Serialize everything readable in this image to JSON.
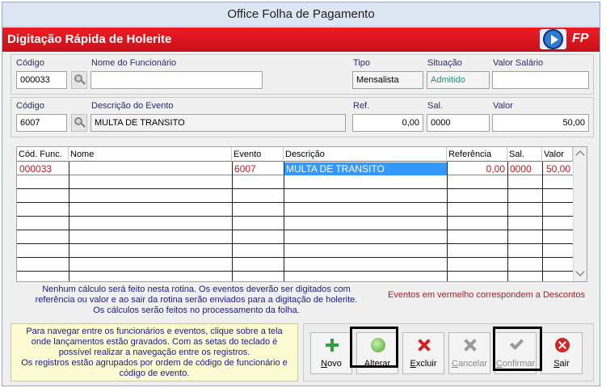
{
  "window": {
    "title": "Office Folha de Pagamento"
  },
  "banner": {
    "title": "Digitação Rápida de Holerite",
    "logo_text": "FP",
    "play_icon": "play-circle-icon"
  },
  "employee": {
    "codigo_label": "Código",
    "codigo_value": "000033",
    "nome_label": "Nome do Funcionário",
    "nome_value": "",
    "tipo_label": "Tipo",
    "tipo_value": "Mensalista",
    "situacao_label": "Situação",
    "situacao_value": "Admitido",
    "salario_label": "Valor Salário",
    "salario_value": ""
  },
  "event": {
    "codigo_label": "Código",
    "codigo_value": "6007",
    "descricao_label": "Descrição do Evento",
    "descricao_value": "MULTA DE TRANSITO",
    "ref_label": "Ref.",
    "ref_value": "0,00",
    "sal_label": "Sal.",
    "sal_value": "0000",
    "valor_label": "Valor",
    "valor_value": "50,00"
  },
  "grid": {
    "columns": [
      "Cód. Func.",
      "Nome",
      "Evento",
      "Descrição",
      "Referência",
      "Sal.",
      "Valor"
    ],
    "rows": [
      {
        "cod_func": "000033",
        "nome": "",
        "evento": "6007",
        "descricao": "MULTA DE TRANSITO",
        "referencia": "0,00",
        "sal": "0000",
        "valor": "50,00"
      }
    ]
  },
  "notes": {
    "info_line1": "Nenhum cálculo será feito nesta rotina. Os eventos deverão ser digitados com",
    "info_line2": "referência ou valor e ao sair da rotina serão enviados para a digitação de holerite.",
    "info_line3": "Os cálculos serão feitos no processamento da folha.",
    "red_events": "Eventos em vermelho correspondem a Descontos"
  },
  "help": {
    "line1": "Para navegar entre os funcionários e eventos, clique sobre a tela",
    "line2": "onde lançamentos estão gravados. Com as setas do teclado é",
    "line3": "possível realizar a navegação entre os registros.",
    "line4": "Os registros estão agrupados por ordem de código de funcionário e",
    "line5": "código de evento."
  },
  "toolbar": {
    "novo": {
      "first": "N",
      "rest": "ovo"
    },
    "alterar": {
      "first": "A",
      "rest": "lterar"
    },
    "excluir": {
      "first": "E",
      "rest": "xcluir"
    },
    "cancelar": {
      "first": "C",
      "rest": "ancelar"
    },
    "confirmar": {
      "first": "C",
      "rest": "onfirmar"
    },
    "sair": {
      "first": "S",
      "rest": "air"
    }
  },
  "colors": {
    "banner": "#e11b22",
    "discount_text": "#c4161c",
    "selection": "#3399ff",
    "info_text": "#1a1a8c"
  }
}
